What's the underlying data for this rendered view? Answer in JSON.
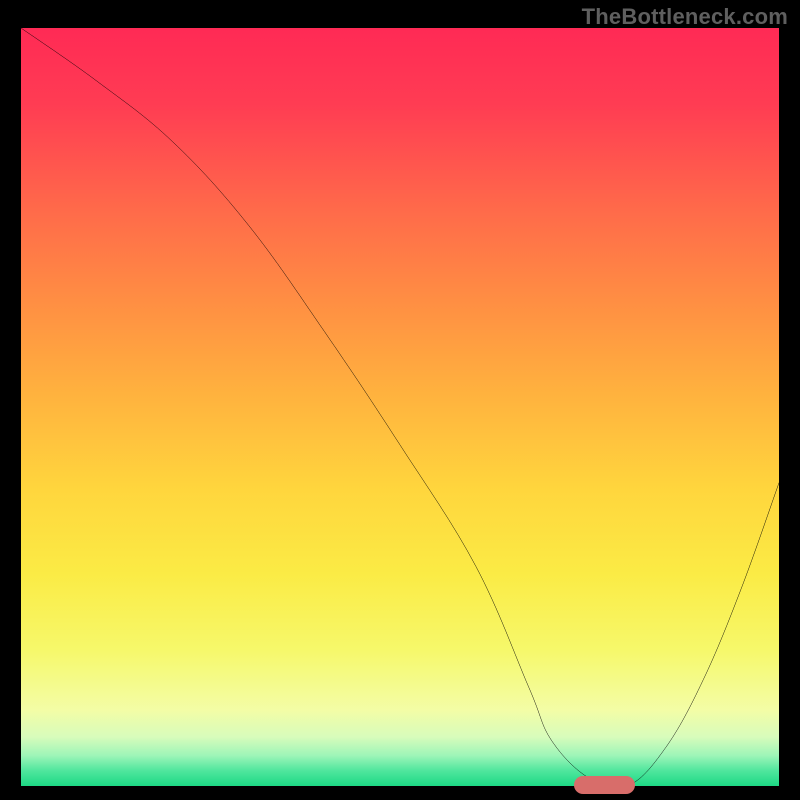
{
  "watermark": "TheBottleneck.com",
  "chart_data": {
    "type": "line",
    "title": "",
    "xlabel": "",
    "ylabel": "",
    "xlim": [
      0,
      100
    ],
    "ylim": [
      0,
      100
    ],
    "grid": false,
    "legend": false,
    "x": [
      0,
      10,
      20,
      30,
      40,
      50,
      60,
      67,
      70,
      75,
      80,
      85,
      90,
      95,
      100
    ],
    "values": [
      100,
      93,
      85,
      74,
      60,
      45,
      29,
      13,
      6,
      1,
      0,
      5,
      14,
      26,
      40
    ],
    "colors": {
      "top": "#ff2a55",
      "mid": "#ffd63d",
      "bottom": "#1dd985",
      "curve": "#000000",
      "marker": "#d86d6a"
    },
    "marker": {
      "x_start": 73,
      "x_end": 81,
      "y": 0
    }
  }
}
